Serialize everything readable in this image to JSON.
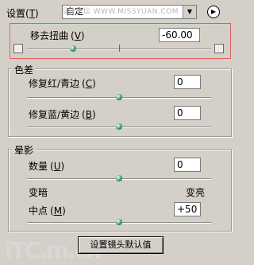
{
  "header": {
    "settings_label": "设置",
    "settings_key": "T",
    "select_value": "自定",
    "select_watermark": "思缘设计论坛 WWW.MISSYUAN.COM"
  },
  "distortion": {
    "label": "移去扭曲",
    "key": "V",
    "value": "-60.00",
    "slider_fraction": 0.25
  },
  "chromatic": {
    "title": "色差",
    "red_cyan_label": "修复红/青边",
    "red_cyan_key": "C",
    "red_cyan_value": "0",
    "red_cyan_fraction": 0.5,
    "blue_yellow_label": "修复蓝/黄边",
    "blue_yellow_key": "B",
    "blue_yellow_value": "0",
    "blue_yellow_fraction": 0.5
  },
  "vignette": {
    "title": "晕影",
    "amount_label": "数量",
    "amount_key": "U",
    "amount_value": "0",
    "amount_fraction": 0.5,
    "darken_label": "变暗",
    "lighten_label": "变亮",
    "midpoint_label": "中点",
    "midpoint_key": "M",
    "midpoint_value": "+50",
    "midpoint_fraction": 0.5
  },
  "reset_button": "设置镜头默认值",
  "watermark_logo": "iTC.m.cn"
}
